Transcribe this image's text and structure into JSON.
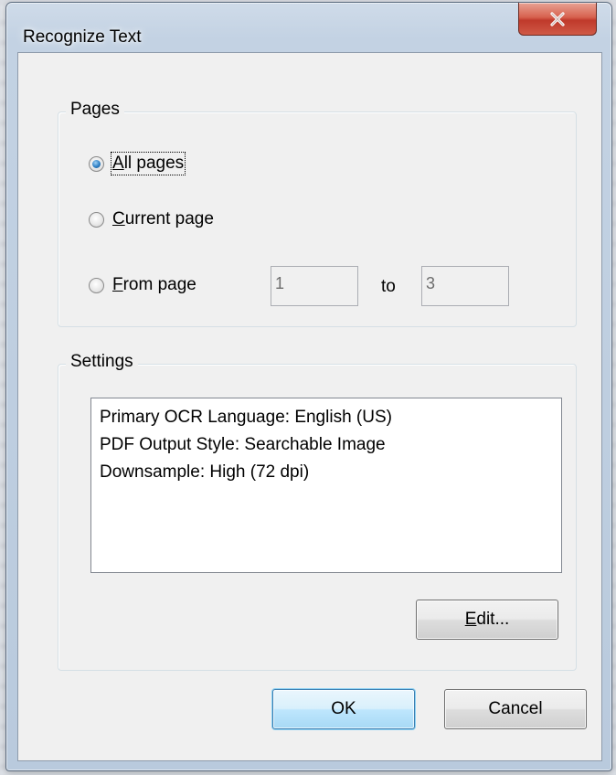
{
  "window": {
    "title": "Recognize Text",
    "close_glyph": "X"
  },
  "pages": {
    "legend": "Pages",
    "options": {
      "all": {
        "mnemonic": "A",
        "rest": "ll pages",
        "selected": true
      },
      "current": {
        "mnemonic": "C",
        "rest": "urrent page",
        "selected": false
      },
      "from": {
        "mnemonic": "F",
        "rest": "rom page",
        "selected": false
      }
    },
    "from_value": "1",
    "to_label": "to",
    "to_value": "3"
  },
  "settings": {
    "legend": "Settings",
    "lines": [
      "Primary OCR Language: English (US)",
      "PDF Output Style: Searchable Image",
      "Downsample: High (72 dpi)"
    ],
    "edit_mnemonic": "E",
    "edit_rest": "dit..."
  },
  "buttons": {
    "ok_label": "OK",
    "cancel_label": "Cancel"
  },
  "icons": {
    "close": "close-icon"
  },
  "colors": {
    "close_button": "#c0392b",
    "radio_selected": "#2d7fc4",
    "ok_button_border": "#3c7fb1"
  }
}
